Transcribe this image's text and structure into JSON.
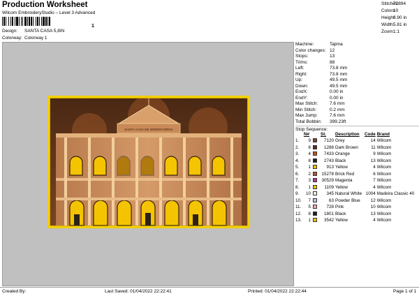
{
  "header": {
    "title": "Production Worksheet",
    "subtitle": "Wilcom EmbroideryStudio – Level 3 Advanced",
    "barcode_mark": "1",
    "design_label": "Design:",
    "design_value": "SANTA CASA 5,8IN",
    "colorway_label": "Colorway:",
    "colorway_value": "Colorway 1"
  },
  "summary": [
    {
      "label": "Stitches:",
      "value": "72894"
    },
    {
      "label": "Colors:",
      "value": "10"
    },
    {
      "label": "Height:",
      "value": "3.90 in"
    },
    {
      "label": "Width:",
      "value": "5.81 in"
    },
    {
      "label": "Zoom:",
      "value": "1:1"
    }
  ],
  "machine_stats": [
    {
      "label": "Machine:",
      "value": "Tajima"
    },
    {
      "label": "Color changes:",
      "value": "12"
    },
    {
      "label": "Stops:",
      "value": "13"
    },
    {
      "label": "Trims:",
      "value": "88"
    },
    {
      "label": "Left:",
      "value": "73.8 mm"
    },
    {
      "label": "Right:",
      "value": "73.8 mm"
    },
    {
      "label": "Up:",
      "value": "49.5 mm"
    },
    {
      "label": "Down:",
      "value": "49.5 mm"
    },
    {
      "label": "EndX:",
      "value": "0.00 in"
    },
    {
      "label": "EndY:",
      "value": "0.00 in"
    },
    {
      "label": "Max Stitch:",
      "value": "7.6 mm"
    },
    {
      "label": "Min Stitch:",
      "value": "0.2 mm"
    },
    {
      "label": "Max Jump:",
      "value": "7.6 mm"
    },
    {
      "label": "Total Bobbin:",
      "value": "399.23ft"
    }
  ],
  "stop_sequence": {
    "title": "Stop Sequence:",
    "headers": {
      "n": "N#",
      "st": "St.",
      "desc": "Description",
      "code": "Code",
      "brand": "Brand"
    },
    "rows": [
      {
        "num": "1.",
        "n": "9",
        "color": "#7a4a2a",
        "st": "7120",
        "desc": "Grey",
        "code": "14",
        "brand": "Wilcom"
      },
      {
        "num": "2.",
        "n": "6",
        "color": "#5a2e1a",
        "st": "1288",
        "desc": "Dark Brown",
        "code": "11",
        "brand": "Wilcom"
      },
      {
        "num": "3.",
        "n": "4",
        "color": "#c0561e",
        "st": "7433",
        "desc": "Orange",
        "code": "9",
        "brand": "Wilcom"
      },
      {
        "num": "4.",
        "n": "8",
        "color": "#2a1d14",
        "st": "2743",
        "desc": "Black",
        "code": "13",
        "brand": "Wilcom"
      },
      {
        "num": "5.",
        "n": "1",
        "color": "#f2c200",
        "st": "913",
        "desc": "Yellow",
        "code": "4",
        "brand": "Wilcom"
      },
      {
        "num": "6.",
        "n": "2",
        "color": "#b2572b",
        "st": "15278",
        "desc": "Brick Red",
        "code": "6",
        "brand": "Wilcom"
      },
      {
        "num": "7.",
        "n": "3",
        "color": "#b03a9a",
        "st": "30529",
        "desc": "Magenta",
        "code": "7",
        "brand": "Wilcom"
      },
      {
        "num": "8.",
        "n": "1",
        "color": "#f2c200",
        "st": "1109",
        "desc": "Yellow",
        "code": "4",
        "brand": "Wilcom"
      },
      {
        "num": "9.",
        "n": "10",
        "color": "#f4f1ea",
        "st": "345",
        "desc": "Natural White",
        "code": "1004",
        "brand": "Madeira Classic 40"
      },
      {
        "num": "10.",
        "n": "7",
        "color": "#b9c3e6",
        "st": "63",
        "desc": "Powder Blue",
        "code": "12",
        "brand": "Wilcom"
      },
      {
        "num": "11.",
        "n": "5",
        "color": "#f0a8b8",
        "st": "728",
        "desc": "Pink",
        "code": "10",
        "brand": "Wilcom"
      },
      {
        "num": "12.",
        "n": "8",
        "color": "#2a1d14",
        "st": "1801",
        "desc": "Black",
        "code": "13",
        "brand": "Wilcom"
      },
      {
        "num": "13.",
        "n": "1",
        "color": "#f2c200",
        "st": "3542",
        "desc": "Yellow",
        "code": "4",
        "brand": "Wilcom"
      }
    ]
  },
  "design_preview": {
    "facade_text": "SANTA CASA DE MISERICORDIA",
    "border_color": "#f2d000",
    "sky_color": "#6b3a1f",
    "facade_color": "#c98a58"
  },
  "footer": {
    "created_by": "Created By:",
    "last_saved": "Last Saved: 01/04/2022 22:22:41",
    "printed": "Printed: 01/04/2022 22:22:44",
    "page": "Page 1 of 1"
  }
}
